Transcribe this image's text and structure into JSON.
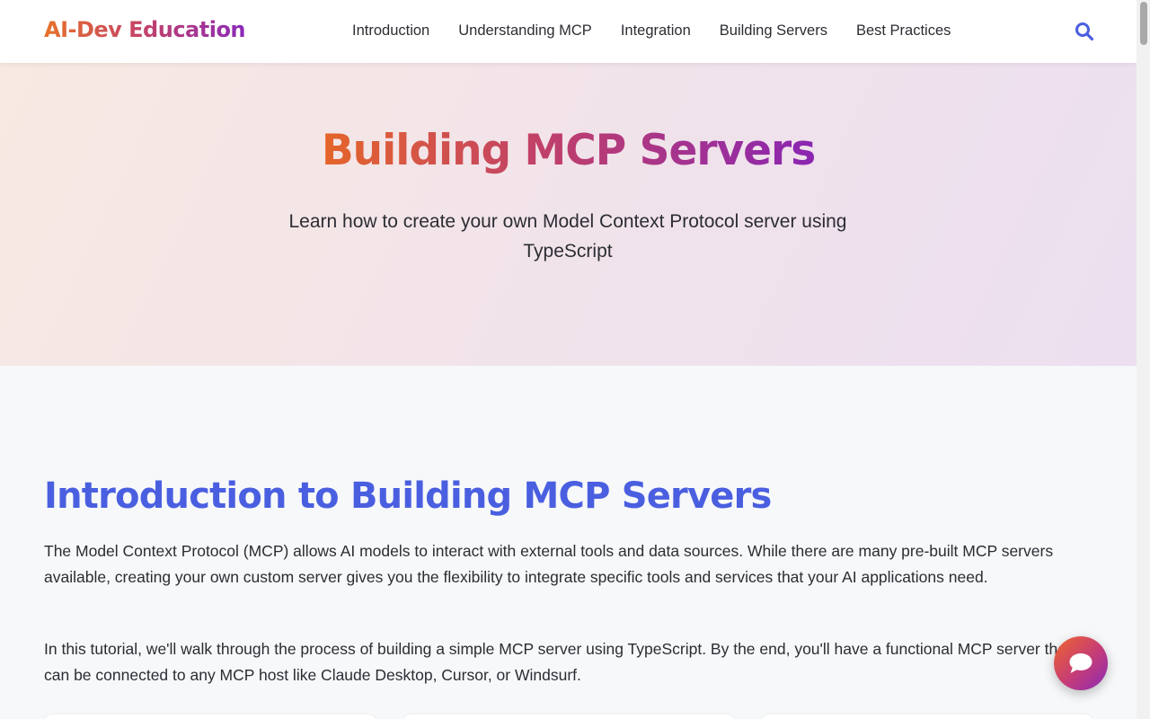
{
  "navbar": {
    "logo": "AI-Dev Education",
    "links": [
      "Introduction",
      "Understanding MCP",
      "Integration",
      "Building Servers",
      "Best Practices"
    ],
    "search_icon": "search-icon"
  },
  "hero": {
    "title": "Building MCP Servers",
    "subtitle": "Learn how to create your own Model Context Protocol server using TypeScript"
  },
  "section": {
    "title": "Introduction to Building MCP Servers",
    "paragraphs": [
      "The Model Context Protocol (MCP) allows AI models to interact with external tools and data sources. While there are many pre-built MCP servers available, creating your own custom server gives you the flexibility to integrate specific tools and services that your AI applications need.",
      "In this tutorial, we'll walk through the process of building a simple MCP server using TypeScript. By the end, you'll have a functional MCP server that can be connected to any MCP host like Claude Desktop, Cursor, or Windsurf."
    ]
  },
  "chat_button": {
    "icon": "chat-bubble-icon"
  },
  "colors": {
    "accent_blue": "#4a5fe0",
    "gradient_start": "#e8722a",
    "gradient_mid": "#c2416a",
    "gradient_end": "#8a2ab8"
  }
}
